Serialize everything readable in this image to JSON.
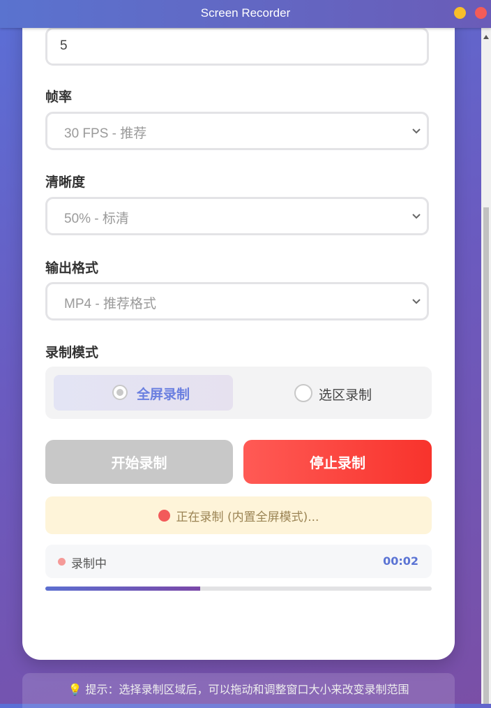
{
  "window": {
    "title": "Screen Recorder"
  },
  "form": {
    "countdown_value": "5",
    "framerate": {
      "label": "帧率",
      "value": "30 FPS - 推荐"
    },
    "quality": {
      "label": "清晰度",
      "value": "50% - 标清"
    },
    "format": {
      "label": "输出格式",
      "value": "MP4 - 推荐格式"
    }
  },
  "mode": {
    "label": "录制模式",
    "options": [
      {
        "label": "全屏录制",
        "selected": true
      },
      {
        "label": "选区录制",
        "selected": false
      }
    ],
    "accent_color": "#6a7fe0"
  },
  "buttons": {
    "start": "开始录制",
    "stop": "停止录制"
  },
  "status": {
    "message": "正在录制 (内置全屏模式)..."
  },
  "recording": {
    "label": "录制中",
    "time": "00:02",
    "progress": 0.4
  },
  "hint": {
    "icon": "lightbulb-icon",
    "text": "提示：选择录制区域后，可以拖动和调整窗口大小来改变录制范围"
  },
  "colors": {
    "stop": "#f8332c",
    "record_dot": "#f25a5a",
    "time": "#5b74d4"
  }
}
